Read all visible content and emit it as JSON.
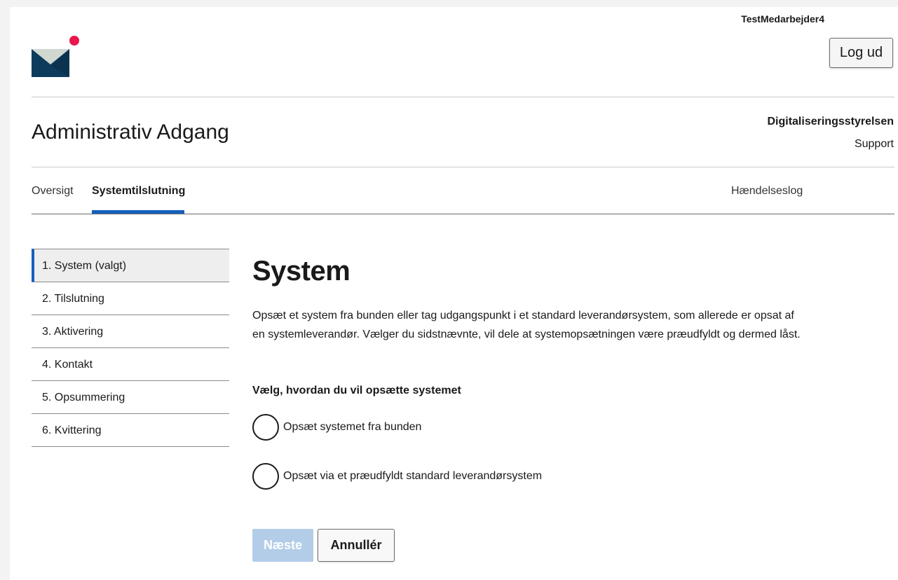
{
  "header": {
    "username": "TestMedarbejder4",
    "logout_label": "Log ud",
    "app_title": "Administrativ Adgang",
    "org_name": "Digitaliseringsstyrelsen",
    "support_label": "Support"
  },
  "nav": {
    "tabs": [
      {
        "label": "Oversigt",
        "active": false
      },
      {
        "label": "Systemtilslutning",
        "active": true
      }
    ],
    "right_tab": "Hændelseslog"
  },
  "steps": [
    {
      "label": "1. System (valgt)",
      "active": true
    },
    {
      "label": "2. Tilslutning",
      "active": false
    },
    {
      "label": "3. Aktivering",
      "active": false
    },
    {
      "label": "4. Kontakt",
      "active": false
    },
    {
      "label": "5. Opsummering",
      "active": false
    },
    {
      "label": "6. Kvittering",
      "active": false
    }
  ],
  "main": {
    "heading": "System",
    "intro": "Opsæt et system fra bunden eller tag udgangspunkt i et standard leverandørsystem, som allerede er opsat af en systemleverandør. Vælger du sidstnævnte, vil dele at systemopsætningen være præudfyldt og dermed låst.",
    "question": "Vælg, hvordan du vil opsætte systemet",
    "options": [
      {
        "label": "Opsæt systemet fra bunden",
        "selected": false
      },
      {
        "label": "Opsæt via et præudfyldt standard leverandørsystem",
        "selected": false
      }
    ],
    "next_label": "Næste",
    "next_disabled": true,
    "cancel_label": "Annullér"
  },
  "colors": {
    "accent": "#1560bd",
    "logo_dark": "#0d3b5c",
    "logo_light": "#d0d8d0",
    "logo_dot": "#e8174f",
    "disabled_button": "#b3cde8"
  },
  "icons": {
    "logo": "envelope-logo-icon",
    "radio": "radio-unchecked-icon"
  }
}
